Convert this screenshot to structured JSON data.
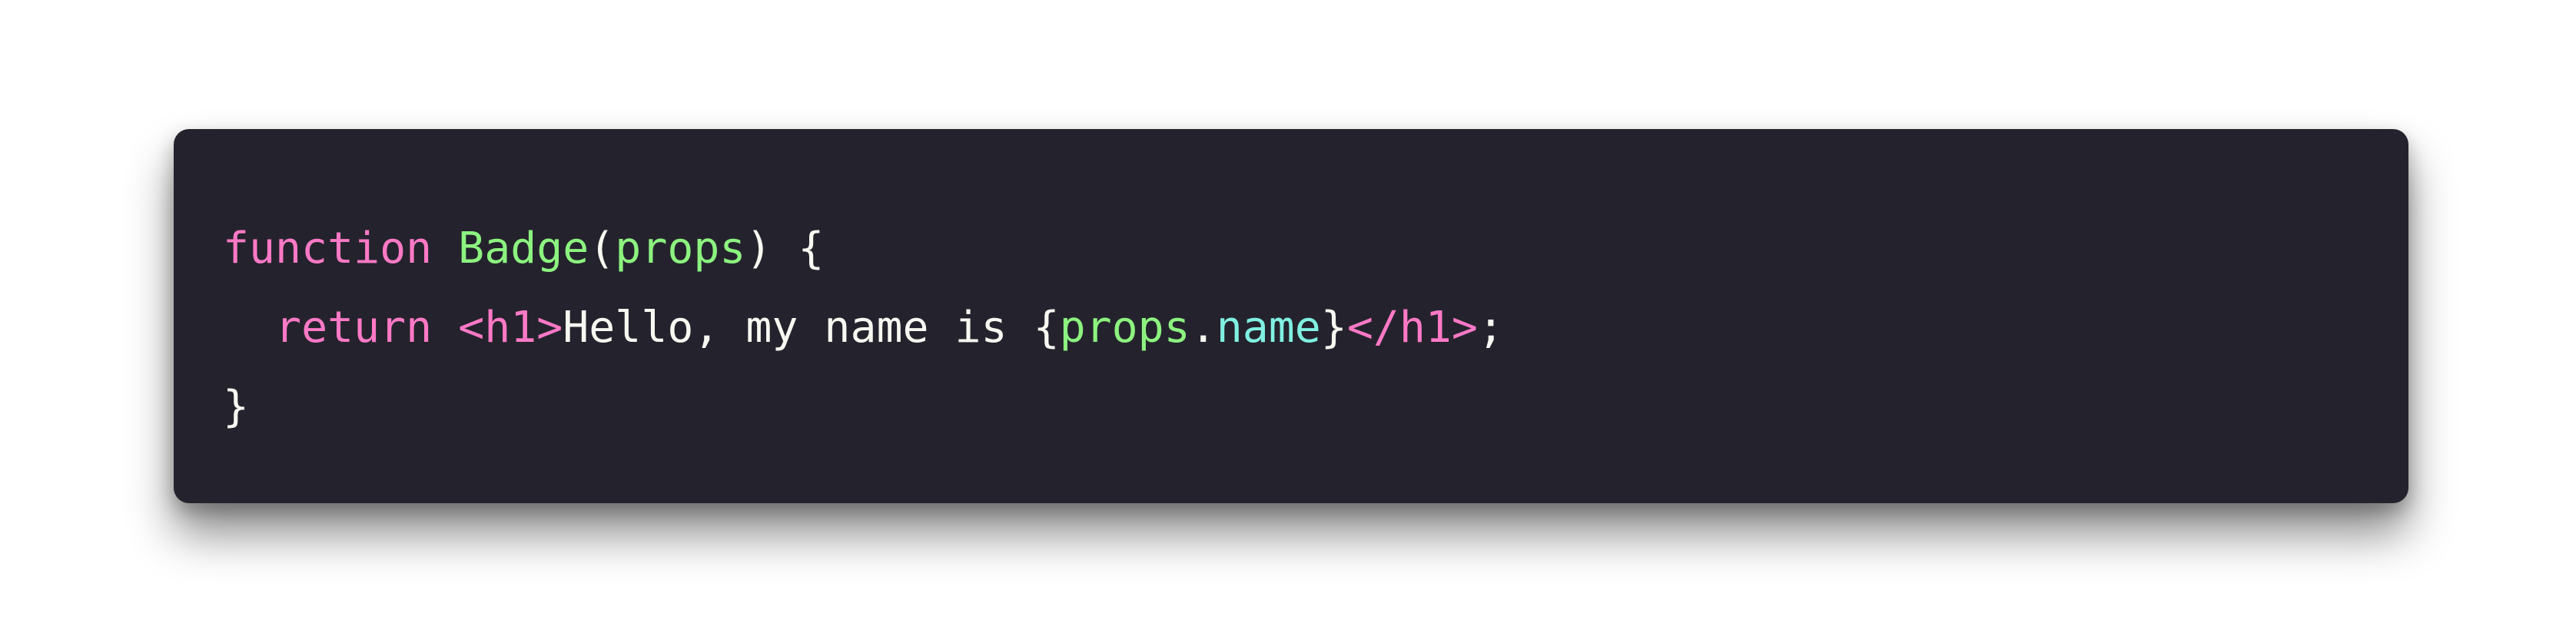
{
  "colors": {
    "background": "#ffffff",
    "editor_background": "#24232d",
    "keyword": "#ff79c6",
    "function_name": "#8cf37f",
    "identifier": "#8cf37f",
    "property": "#80f0e2",
    "plain_text": "#f8f8f2"
  },
  "code": {
    "line1": {
      "kw_function": "function",
      "name": "Badge",
      "open_paren": "(",
      "param": "props",
      "close_paren_brace": ") {"
    },
    "line2": {
      "indent": "  ",
      "kw_return": "return",
      "tag_open": "<h1>",
      "text": "Hello, my name is ",
      "expr_open": "{",
      "obj": "props",
      "dot": ".",
      "prop": "name",
      "expr_close": "}",
      "tag_close": "</h1>",
      "semicolon": ";"
    },
    "line3": {
      "close_brace": "}"
    }
  }
}
